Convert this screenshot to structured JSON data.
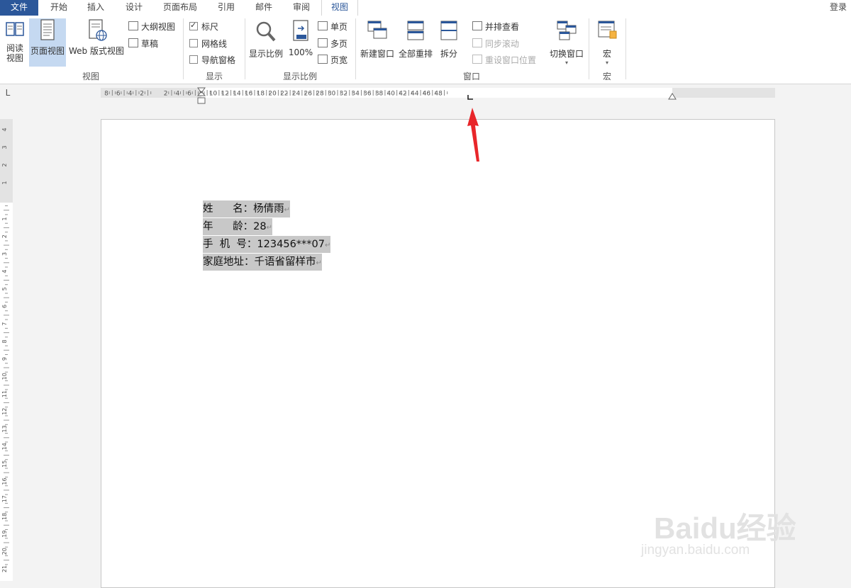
{
  "tabs": {
    "file": "文件",
    "home": "开始",
    "insert": "插入",
    "design": "设计",
    "layout": "页面布局",
    "references": "引用",
    "mailings": "邮件",
    "review": "审阅",
    "view": "视图"
  },
  "login": "登录",
  "ribbon": {
    "views_group": {
      "label": "视图",
      "read_mode": [
        "阅读",
        "视图"
      ],
      "print_layout": "页面视图",
      "web_layout": "Web 版式视图",
      "outline": "大纲视图",
      "draft": "草稿"
    },
    "show_group": {
      "label": "显示",
      "ruler": {
        "label": "标尺",
        "checked": true
      },
      "gridlines": {
        "label": "网格线",
        "checked": false
      },
      "nav_pane": {
        "label": "导航窗格",
        "checked": false
      }
    },
    "zoom_group": {
      "label": "显示比例",
      "zoom": "显示比例",
      "hundred": "100%",
      "one_page": "单页",
      "multi_page": "多页",
      "page_width": "页宽"
    },
    "window_group": {
      "label": "窗口",
      "new_window": "新建窗口",
      "arrange_all": "全部重排",
      "split": "拆分",
      "side_by_side": "并排查看",
      "sync_scroll": "同步滚动",
      "reset_position": "重设窗口位置",
      "switch_windows": "切换窗口"
    },
    "macros_group": {
      "label": "宏",
      "macros": "宏"
    }
  },
  "ruler": {
    "h_ticks": [
      "8",
      "6",
      "4",
      "2",
      "2",
      "4",
      "6",
      "8",
      "10",
      "12",
      "14",
      "16",
      "18",
      "20",
      "22",
      "24",
      "26",
      "28",
      "30",
      "32",
      "34",
      "36",
      "38",
      "40",
      "42",
      "44",
      "46",
      "48"
    ],
    "v_ticks_top": [
      "4",
      "3",
      "2",
      "1"
    ],
    "v_ticks": [
      "1",
      "2",
      "3",
      "4",
      "5",
      "6",
      "7",
      "8",
      "9",
      "10",
      "11",
      "12",
      "13",
      "14",
      "15",
      "16",
      "17",
      "18",
      "19",
      "20",
      "21"
    ],
    "corner": "L"
  },
  "document": {
    "lines": [
      "姓      名：杨倩雨",
      "年      龄：28",
      "手  机  号：123456***07",
      "家庭地址：千语省留样市"
    ],
    "para_mark": "↵"
  },
  "watermark": {
    "logo": "Baidu经验",
    "url": "jingyan.baidu.com"
  },
  "colors": {
    "file_tab": "#2b579a",
    "selection": "#c8c8c8",
    "arrow": "#e8262a",
    "selected_btn": "#c5d9f1"
  }
}
